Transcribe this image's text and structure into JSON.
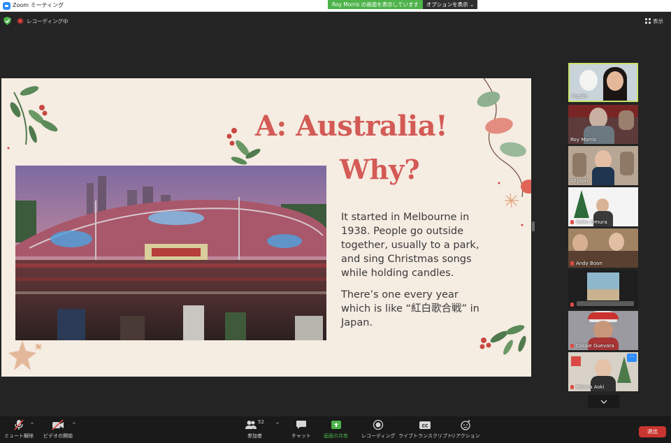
{
  "window": {
    "title": "Zoom ミーティング"
  },
  "share_banner": {
    "text": "Roy Morris の画面を表示しています",
    "options_label": "オプションを表示"
  },
  "top_bar": {
    "recording_label": "レコーディング中",
    "view_label": "表示"
  },
  "slide": {
    "title": "A: Australia!",
    "subtitle": "Why?",
    "paragraph_1": "It started in Melbourne in 1938.  People go outside together, usually to a park, and sing Christmas songs while holding candles.",
    "paragraph_2": "There’s one every year which is like “紅白歌合戦” in Japan."
  },
  "participants": [
    {
      "name": "Maslin",
      "active": true
    },
    {
      "name": "Roy Morris",
      "active": false
    },
    {
      "name": "Allyson",
      "active": false
    },
    {
      "name": "Keiko Omura",
      "active": false
    },
    {
      "name": "Andy Boon",
      "active": false
    },
    {
      "name": "",
      "active": false
    },
    {
      "name": "Cassie Guevara",
      "active": false
    },
    {
      "name": "Manna Aoki",
      "active": false
    }
  ],
  "toolbar": {
    "unmute_label": "ミュート解除",
    "video_label": "ビデオの開始",
    "participants_label": "参加者",
    "participants_count": "52",
    "chat_label": "チャット",
    "share_label": "画面の共有",
    "record_label": "レコーディング",
    "transcript_label": "ライブトランスクリプト",
    "reactions_label": "リアクション",
    "end_label": "退出"
  },
  "colors": {
    "accent_green": "#4db34a",
    "slide_heading": "#d35a55",
    "end_red": "#c9352f"
  }
}
